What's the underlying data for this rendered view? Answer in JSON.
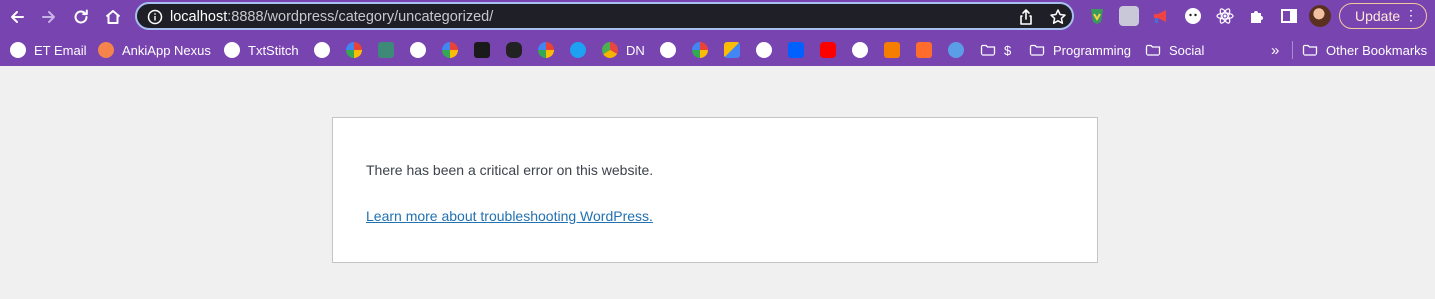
{
  "browser": {
    "url_host": "localhost",
    "url_path": ":8888/wordpress/category/uncategorized/",
    "update_label": "Update",
    "menu_glyph": "⋮"
  },
  "bookmarks": {
    "items": [
      {
        "label": "ET Email",
        "icon": "globe-icon",
        "color": "#ffffff"
      },
      {
        "label": "AnkiApp Nexus",
        "icon": "ankiapp-icon",
        "color": "#f4844b"
      },
      {
        "label": "TxtStitch",
        "icon": "globe-icon",
        "color": "#ffffff"
      },
      {
        "label": "DN",
        "icon": "globe-icon",
        "color": "#ffffff"
      },
      {
        "label": "$",
        "icon": "folder-icon",
        "color": "#ffffff"
      },
      {
        "label": "Programming",
        "icon": "folder-icon",
        "color": "#ffffff"
      },
      {
        "label": "Social",
        "icon": "folder-icon",
        "color": "#ffffff"
      },
      {
        "label": "Other Bookmarks",
        "icon": "folder-icon",
        "color": "#ffffff"
      }
    ],
    "overflow_glyph": "»"
  },
  "error_page": {
    "message": "There has been a critical error on this website.",
    "link_text": "Learn more about troubleshooting WordPress."
  },
  "colors": {
    "toolbar": "#7844b0",
    "page_bg": "#f0f0f1",
    "link": "#2271b1",
    "text": "#3c434a"
  }
}
